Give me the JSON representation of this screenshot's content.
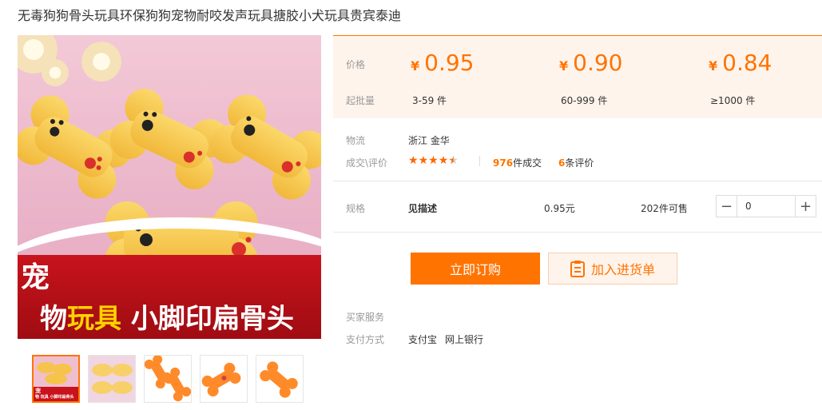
{
  "title": "无毒狗狗骨头玩具环保狗狗宠物耐咬发声玩具搪胶小犬玩具贵宾泰迪",
  "image": {
    "banner_line1": "宠",
    "banner_line2_a": "物",
    "banner_line2_b": "玩具",
    "banner_line2_c": "小脚印扁骨头",
    "thumb_banner_a": "宠",
    "thumb_banner_b": "物 玩具 小脚印扁骨头"
  },
  "price": {
    "price_label": "价格",
    "moq_label": "起批量",
    "currency": "¥",
    "tiers": [
      {
        "price": "0.95",
        "qty": "3-59 件"
      },
      {
        "price": "0.90",
        "qty": "60-999 件"
      },
      {
        "price": "0.84",
        "qty": "≥1000 件"
      }
    ]
  },
  "logistics": {
    "label": "物流",
    "value": "浙江 金华"
  },
  "deals": {
    "label": "成交\\评价",
    "rating_stars": 4.5,
    "deal_count": "976",
    "deal_suffix": "件成交",
    "review_count": "6",
    "review_suffix": "条评价"
  },
  "spec": {
    "label": "规格",
    "name": "见描述",
    "price": "0.95元",
    "stock": "202件可售",
    "quantity": "0"
  },
  "buttons": {
    "buy": "立即订购",
    "cart": "加入进货单"
  },
  "services": {
    "label": "买家服务"
  },
  "payment": {
    "label": "支付方式",
    "methods": [
      "支付宝",
      "网上银行"
    ]
  },
  "colors": {
    "accent": "#ff7300",
    "price_bg": "#fff4ec",
    "banner_red": "#c8131c"
  }
}
